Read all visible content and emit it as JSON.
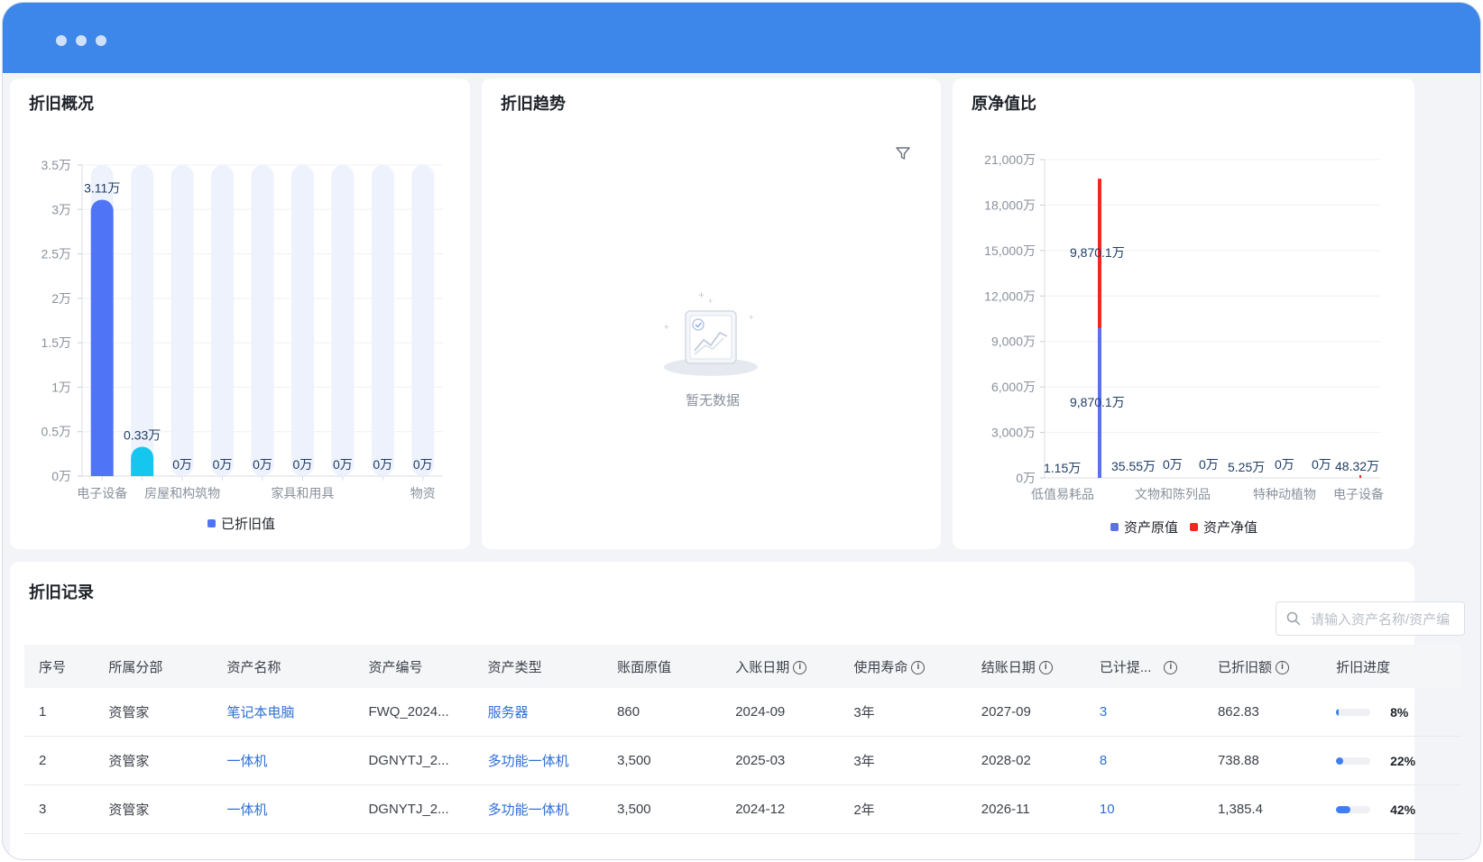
{
  "colors": {
    "titlebar": "#3d86ea",
    "bar_primary": "#4f75f6",
    "bar_secondary": "#15c6ef",
    "bar_track": "#eef2fc",
    "original_value": "#5b72e6",
    "net_value": "#f2281c",
    "link": "#2f6fd6"
  },
  "cards": {
    "overview_title": "折旧概况",
    "trend_title": "折旧趋势",
    "ratio_title": "原净值比",
    "records_title": "折旧记录"
  },
  "trend": {
    "empty_text": "暂无数据",
    "filter_icon": "filter-icon"
  },
  "search": {
    "placeholder": "请输入资产名称/资产编",
    "icon": "search-icon"
  },
  "chart_data": [
    {
      "type": "bar",
      "title": "折旧概况",
      "y_ticks": [
        "0万",
        "0.5万",
        "1万",
        "1.5万",
        "2万",
        "2.5万",
        "3万",
        "3.5万"
      ],
      "ylim": [
        0,
        3.5
      ],
      "unit": "万",
      "categories": [
        "电子设备",
        "",
        "房屋和构筑物",
        "",
        "",
        "家具和用具",
        "",
        "",
        "物资"
      ],
      "series": [
        {
          "name": "已折旧值",
          "values": [
            3.11,
            0.33,
            0,
            0,
            0,
            0,
            0,
            0,
            0
          ]
        }
      ],
      "data_labels": [
        "3.11万",
        "0.33万",
        "0万",
        "0万",
        "0万",
        "0万",
        "0万",
        "0万",
        "0万"
      ],
      "legend": "bottom-center",
      "grid": true
    },
    {
      "type": "bar",
      "title": "原净值比",
      "y_ticks": [
        "0万",
        "3,000万",
        "6,000万",
        "9,000万",
        "12,000万",
        "15,000万",
        "18,000万",
        "21,000万"
      ],
      "ylim": [
        0,
        21000
      ],
      "unit": "万",
      "x_tick_labels": [
        "低值易耗品",
        "文物和陈列品",
        "特种动植物",
        "电子设备"
      ],
      "series": [
        {
          "name": "资产原值",
          "values": [
            9870.1,
            1.15,
            35.55,
            0,
            0,
            5.25,
            0,
            0,
            48.32
          ]
        },
        {
          "name": "资产净值",
          "values": [
            9870.1,
            0,
            0,
            0,
            0,
            0,
            0,
            0,
            0
          ]
        }
      ],
      "stacked": true,
      "data_labels": [
        "9,870.1万",
        "9,870.1万",
        "1.15万",
        "35.55万",
        "0万",
        "0万",
        "5.25万",
        "0万",
        "0万",
        "48.32万"
      ],
      "legend": "bottom-center",
      "grid": true
    }
  ],
  "table": {
    "headers": [
      "序号",
      "所属分部",
      "资产名称",
      "资产编号",
      "资产类型",
      "账面原值",
      "入账日期",
      "使用寿命",
      "结账日期",
      "已计提...",
      "已折旧额",
      "折旧进度"
    ],
    "info_icon": "info-icon",
    "rows": [
      {
        "no": "1",
        "dept": "资管家",
        "name": "笔记本电脑",
        "code": "FWQ_2024...",
        "type": "服务器",
        "book_value": "860",
        "entry_date": "2024-09",
        "life": "3年",
        "close_date": "2027-09",
        "accrued": "3",
        "depreciated": "862.83",
        "progress": 0.08,
        "progress_label": "8%"
      },
      {
        "no": "2",
        "dept": "资管家",
        "name": "一体机",
        "code": "DGNYTJ_2...",
        "type": "多功能一体机",
        "book_value": "3,500",
        "entry_date": "2025-03",
        "life": "3年",
        "close_date": "2028-02",
        "accrued": "8",
        "depreciated": "738.88",
        "progress": 0.22,
        "progress_label": "22%"
      },
      {
        "no": "3",
        "dept": "资管家",
        "name": "一体机",
        "code": "DGNYTJ_2...",
        "type": "多功能一体机",
        "book_value": "3,500",
        "entry_date": "2024-12",
        "life": "2年",
        "close_date": "2026-11",
        "accrued": "10",
        "depreciated": "1,385.4",
        "progress": 0.42,
        "progress_label": "42%"
      }
    ]
  }
}
